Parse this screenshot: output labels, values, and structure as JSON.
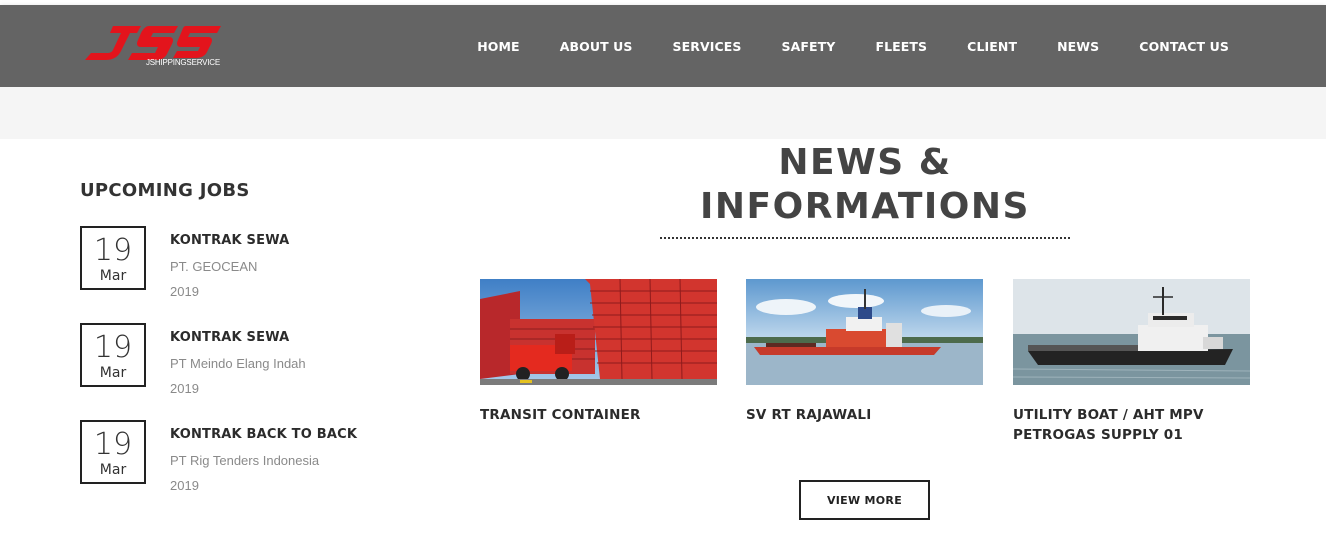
{
  "header": {
    "logo_tagline": "JSHIPPINGSERVICE",
    "logo_mark": "JSS",
    "nav": [
      "HOME",
      "ABOUT US",
      "SERVICES",
      "SAFETY",
      "FLEETS",
      "CLIENT",
      "NEWS",
      "CONTACT US"
    ]
  },
  "jobs": {
    "title": "UPCOMING JOBS",
    "items": [
      {
        "day": "19",
        "month": "Mar",
        "title": "KONTRAK SEWA",
        "company": "PT. GEOCEAN",
        "year": "2019"
      },
      {
        "day": "19",
        "month": "Mar",
        "title": "KONTRAK SEWA",
        "company": "PT Meindo Elang Indah",
        "year": "2019"
      },
      {
        "day": "19",
        "month": "Mar",
        "title": "KONTRAK BACK TO BACK",
        "company": "PT Rig Tenders Indonesia",
        "year": "2019"
      }
    ]
  },
  "news": {
    "title": "NEWS & INFORMATIONS",
    "cards": [
      {
        "title": "TRANSIT CONTAINER",
        "image": "container-yard-photo"
      },
      {
        "title": "SV RT RAJAWALI",
        "image": "red-supply-vessel-photo"
      },
      {
        "title": "UTILITY BOAT / AHT MPV PETROGAS SUPPLY 01",
        "image": "utility-boat-photo"
      }
    ],
    "view_more": "VIEW MORE"
  },
  "colors": {
    "header_bg": "#646464",
    "brand_red": "#e3141c",
    "text_dark": "#2b2b2b",
    "text_muted": "#8a8a8a"
  }
}
